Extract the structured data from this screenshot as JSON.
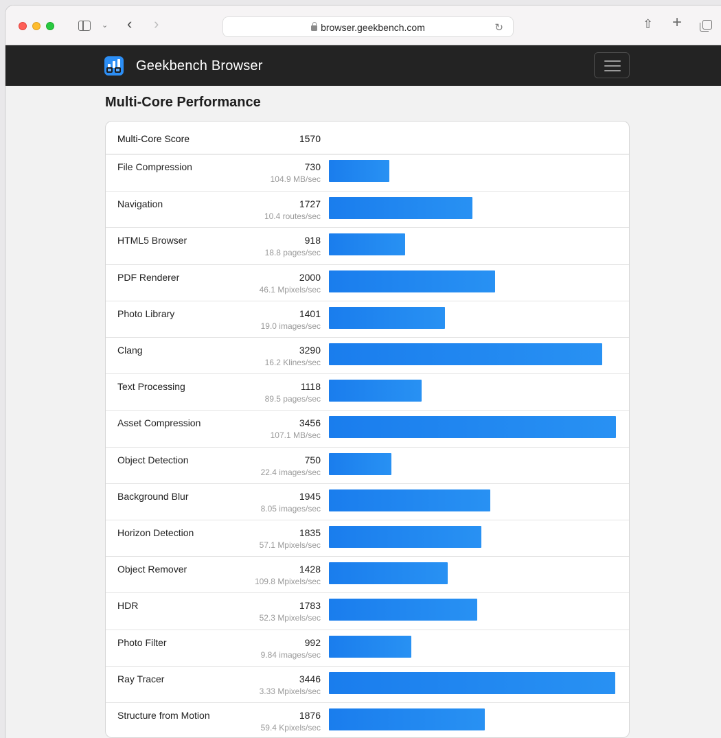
{
  "browser": {
    "url": "browser.geekbench.com"
  },
  "site": {
    "brand": "Geekbench Browser"
  },
  "section_title": "Multi-Core Performance",
  "table": {
    "header_label": "Multi-Core Score",
    "header_score": "1570",
    "bar_max_score": 3456,
    "bar_color": "#1a7ded",
    "rows": [
      {
        "name": "File Compression",
        "score": "730",
        "rate": "104.9 MB/sec"
      },
      {
        "name": "Navigation",
        "score": "1727",
        "rate": "10.4 routes/sec"
      },
      {
        "name": "HTML5 Browser",
        "score": "918",
        "rate": "18.8 pages/sec"
      },
      {
        "name": "PDF Renderer",
        "score": "2000",
        "rate": "46.1 Mpixels/sec"
      },
      {
        "name": "Photo Library",
        "score": "1401",
        "rate": "19.0 images/sec"
      },
      {
        "name": "Clang",
        "score": "3290",
        "rate": "16.2 Klines/sec"
      },
      {
        "name": "Text Processing",
        "score": "1118",
        "rate": "89.5 pages/sec"
      },
      {
        "name": "Asset Compression",
        "score": "3456",
        "rate": "107.1 MB/sec"
      },
      {
        "name": "Object Detection",
        "score": "750",
        "rate": "22.4 images/sec"
      },
      {
        "name": "Background Blur",
        "score": "1945",
        "rate": "8.05 images/sec"
      },
      {
        "name": "Horizon Detection",
        "score": "1835",
        "rate": "57.1 Mpixels/sec"
      },
      {
        "name": "Object Remover",
        "score": "1428",
        "rate": "109.8 Mpixels/sec"
      },
      {
        "name": "HDR",
        "score": "1783",
        "rate": "52.3 Mpixels/sec"
      },
      {
        "name": "Photo Filter",
        "score": "992",
        "rate": "9.84 images/sec"
      },
      {
        "name": "Ray Tracer",
        "score": "3446",
        "rate": "3.33 Mpixels/sec"
      },
      {
        "name": "Structure from Motion",
        "score": "1876",
        "rate": "59.4 Kpixels/sec"
      }
    ]
  },
  "chart_data": {
    "type": "bar",
    "categories": [
      "File Compression",
      "Navigation",
      "HTML5 Browser",
      "PDF Renderer",
      "Photo Library",
      "Clang",
      "Text Processing",
      "Asset Compression",
      "Object Detection",
      "Background Blur",
      "Horizon Detection",
      "Object Remover",
      "HDR",
      "Photo Filter",
      "Ray Tracer",
      "Structure from Motion"
    ],
    "values": [
      730,
      1727,
      918,
      2000,
      1401,
      3290,
      1118,
      3456,
      750,
      1945,
      1835,
      1428,
      1783,
      992,
      3446,
      1876
    ],
    "title": "Multi-Core Performance",
    "xlabel": "",
    "ylabel": ""
  },
  "icons": {
    "lock": "lock-icon",
    "reload": "reload-icon",
    "share": "share-icon",
    "new_tab": "plus-icon",
    "tab_overview": "tabs-icon",
    "sidebar": "sidebar-icon",
    "menu": "hamburger-menu-icon"
  }
}
